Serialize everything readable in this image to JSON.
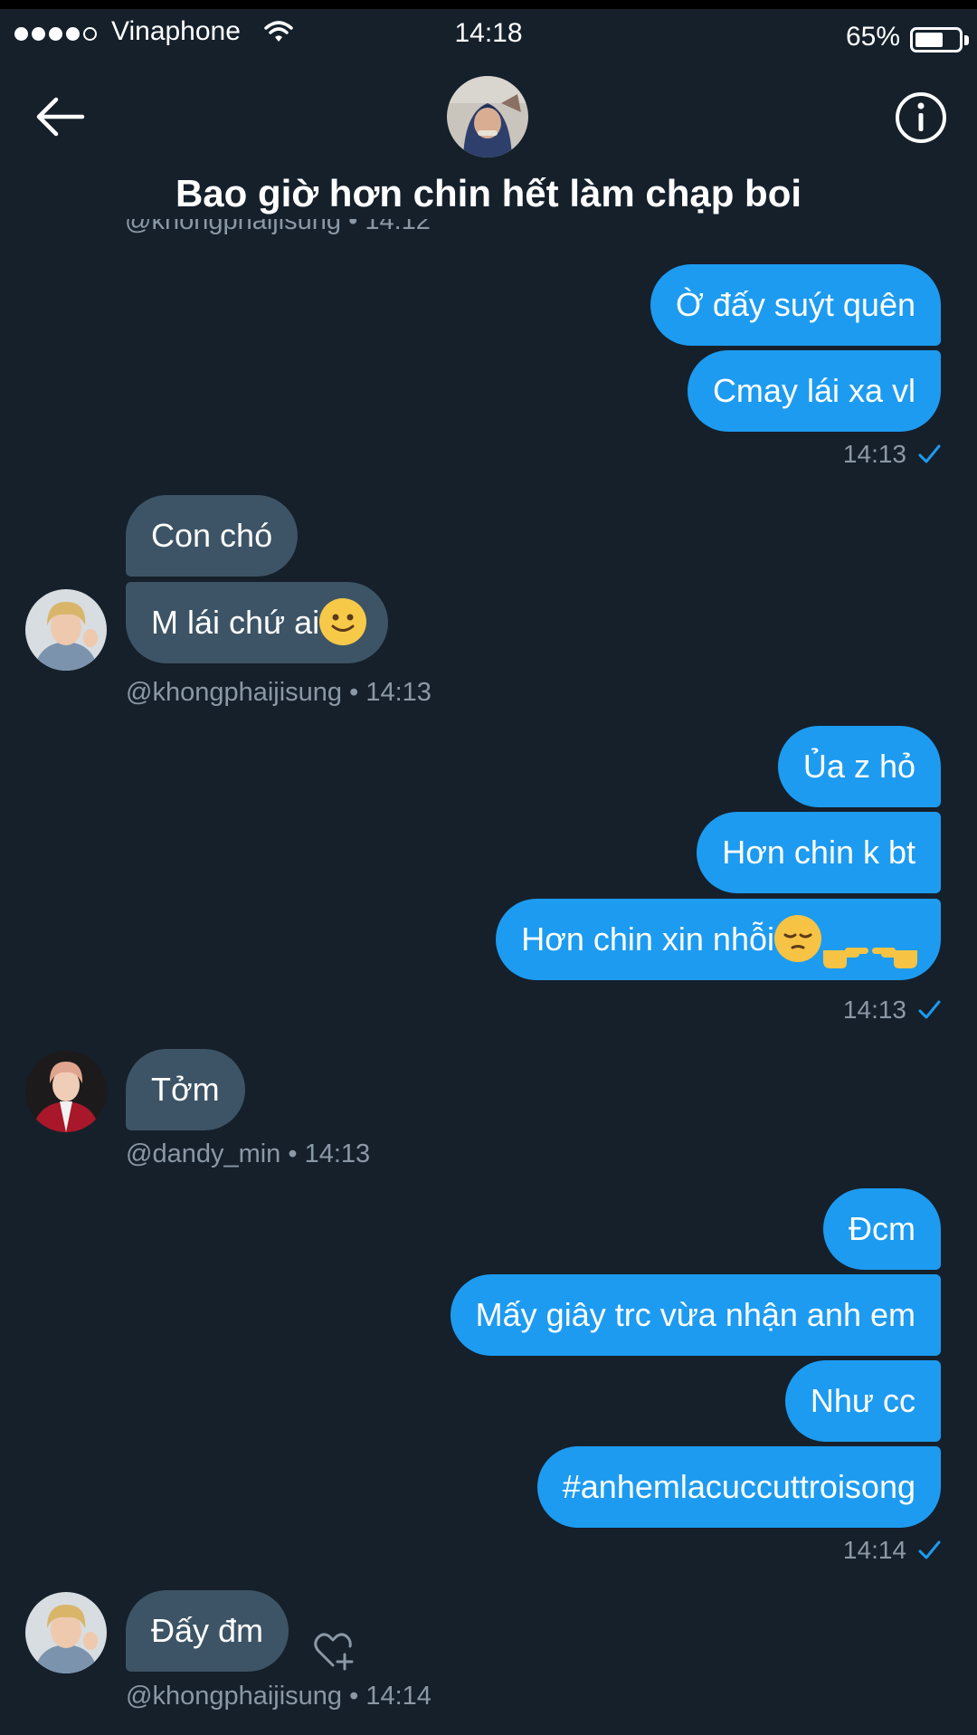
{
  "status": {
    "carrier": "Vinaphone",
    "time": "14:18",
    "battery": "65%",
    "battery_level": 0.65
  },
  "header": {
    "title": "Bao giờ hơn chin hết làm chạp boi",
    "cut_meta": "@khongphaijisung • 14:12"
  },
  "messages": {
    "g1": {
      "m1": "Ờ đấy suýt quên",
      "m2": "Cmay lái xa vl",
      "time": "14:13"
    },
    "g2": {
      "m1": "Con chó",
      "m2": "M lái chứ ai",
      "meta": "@khongphaijisung • 14:13"
    },
    "g3": {
      "m1": "Ủa z hỏ",
      "m2": "Hơn chin k bt",
      "m3": "Hơn chin xin nhỗi",
      "time": "14:13"
    },
    "g4": {
      "m1": "Tởm",
      "meta": "@dandy_min • 14:13"
    },
    "g5": {
      "m1": "Đcm",
      "m2": "Mấy giây trc vừa nhận anh em",
      "m3": "Như cc",
      "m4": "#anhemlacuccuttroisong",
      "time": "14:14"
    },
    "g6": {
      "m1": "Đấy đm",
      "meta": "@khongphaijisung • 14:14"
    }
  },
  "icons": {
    "back": "arrow-left-icon",
    "info": "info-icon",
    "read": "checkmark-icon",
    "react": "heart-plus-icon"
  },
  "colors": {
    "background": "#15202b",
    "outgoing_bubble": "#1d9bf0",
    "incoming_bubble": "#3d5466",
    "meta_text": "#8b98a5"
  }
}
